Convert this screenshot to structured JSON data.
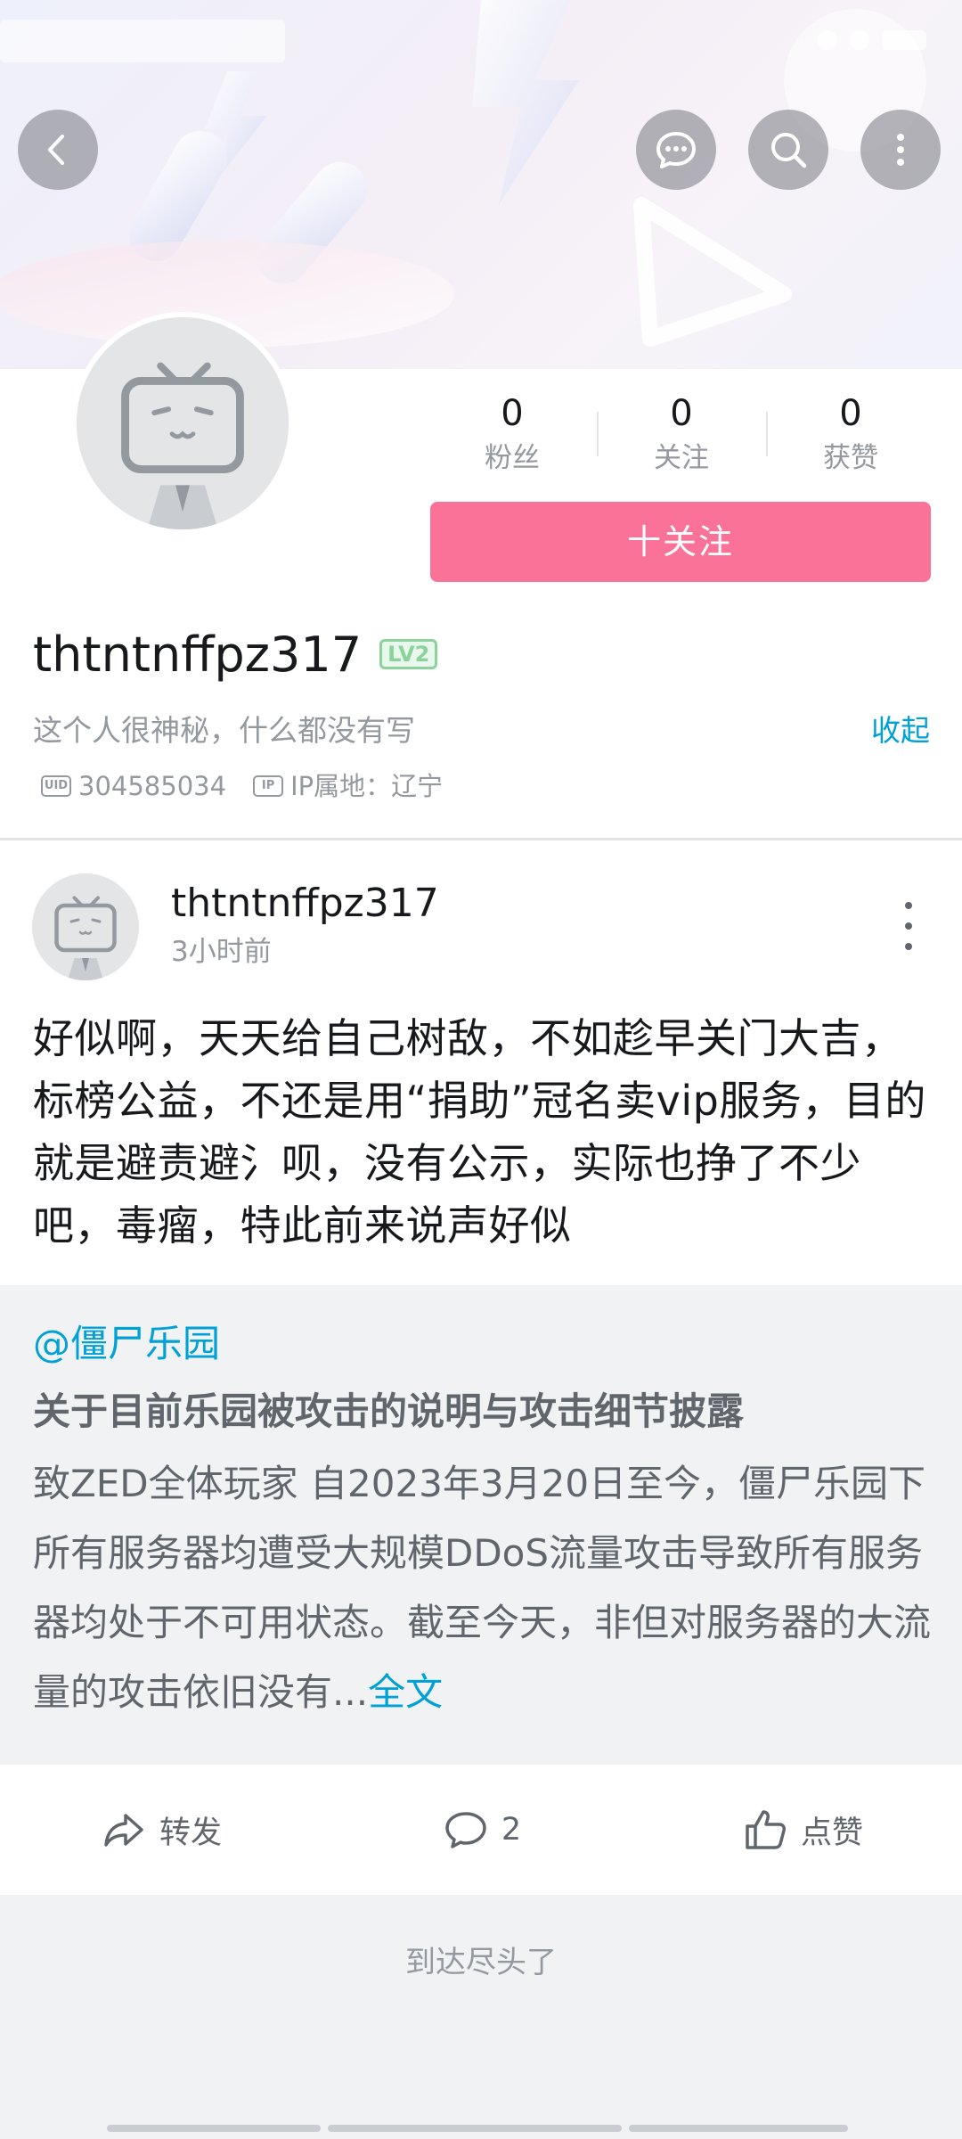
{
  "header": {
    "back_label": "返回",
    "colors": {
      "accent": "#fb7299",
      "link": "#00a1d6",
      "muted": "#9499a0"
    }
  },
  "profile": {
    "stats": [
      {
        "value": "0",
        "label": "粉丝"
      },
      {
        "value": "0",
        "label": "关注"
      },
      {
        "value": "0",
        "label": "获赞"
      }
    ],
    "follow_label": "十关注",
    "username": "thtntnffpz317",
    "level_badge": "LV2",
    "bio": "这个人很神秘，什么都没有写",
    "collapse_label": "收起",
    "uid_tag": "UID",
    "uid": "304585034",
    "ip_tag": "IP",
    "ip_location": "IP属地：辽宁"
  },
  "post": {
    "author": "thtntnffpz317",
    "time": "3小时前",
    "text": "好似啊，天天给自己树敌，不如趁早关门大吉，标榜公益，不还是用“捐助”冠名卖vip服务，目的就是避责避氵呗，没有公示，实际也挣了不少吧，毒瘤，特此前来说声好似",
    "repost": {
      "at_user": "@僵尸乐园",
      "title": "关于目前乐园被攻击的说明与攻击细节披露",
      "body": "致ZED全体玩家 自2023年3月20日至今，僵尸乐园下所有服务器均遭受大规模DDoS流量攻击导致所有服务器均处于不可用状态。截至今天，非但对服务器的大流量的攻击依旧没有...",
      "more_label": "全文"
    },
    "actions": {
      "share_label": "转发",
      "comment_count": "2",
      "like_label": "点赞"
    }
  },
  "footer": {
    "end_text": "到达尽头了"
  },
  "icons": [
    "back-icon",
    "chat-icon",
    "search-icon",
    "more-icon",
    "share-icon",
    "comment-icon",
    "like-icon"
  ]
}
